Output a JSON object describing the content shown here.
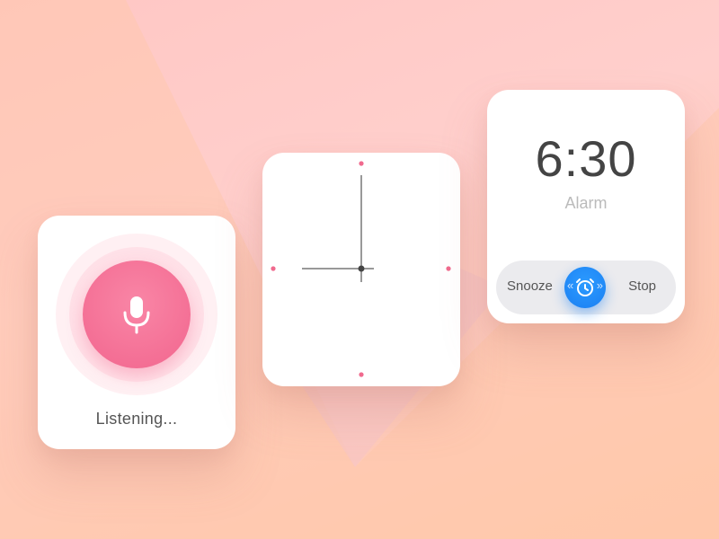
{
  "voice": {
    "status_text": "Listening...",
    "mic_icon": "microphone-icon",
    "accent": "#f46f95"
  },
  "clock": {
    "hour_markers": [
      "12",
      "3",
      "6",
      "9"
    ],
    "dot_color": "#f06a8e",
    "hand_color": "#333333"
  },
  "alarm": {
    "time": "6:30",
    "label": "Alarm",
    "snooze_label": "Snooze",
    "stop_label": "Stop",
    "knob_icon": "alarm-clock-icon",
    "accent": "#1a7ff2"
  }
}
